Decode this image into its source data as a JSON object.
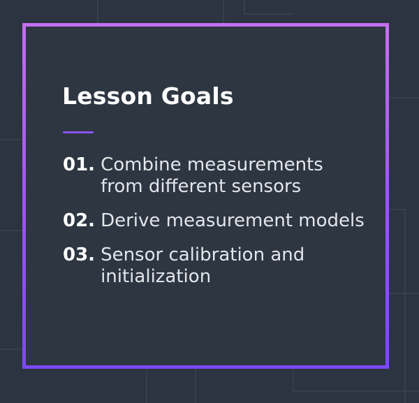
{
  "colors": {
    "background": "#2b3440",
    "panel": "#2d3641",
    "frame_gradient_start": "#7b49f2",
    "frame_gradient_end": "#c56ef0",
    "accent": "#8a55f6",
    "text": "#ffffff"
  },
  "slide": {
    "title": "Lesson Goals",
    "goals": [
      {
        "number": "01.",
        "line1": "Combine measurements",
        "line2": "from different sensors"
      },
      {
        "number": "02.",
        "line1": "Derive measurement models",
        "line2": ""
      },
      {
        "number": "03.",
        "line1": "Sensor calibration and",
        "line2": "initialization"
      }
    ]
  }
}
